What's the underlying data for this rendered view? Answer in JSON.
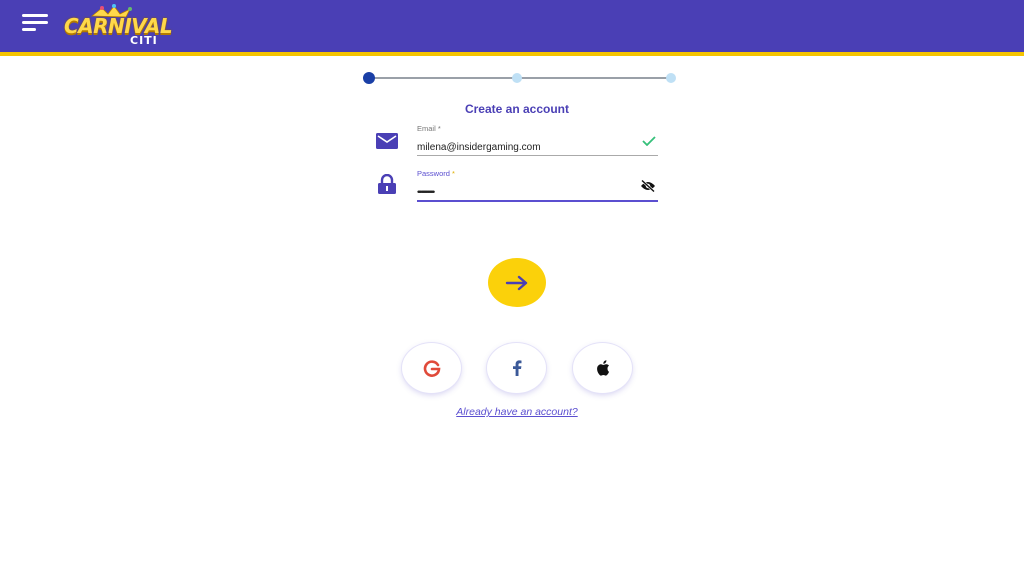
{
  "header": {
    "menu_icon": "hamburger-menu-icon",
    "logo": {
      "main": "CARNIVAL",
      "sub": "CITI"
    },
    "colors": {
      "bar": "#4a3fb5",
      "stripe": "#f5c400"
    }
  },
  "stepper": {
    "steps": 3,
    "current_step": 1
  },
  "form": {
    "title": "Create an account",
    "email": {
      "icon": "envelope-icon",
      "label": "Email",
      "required_mark": "*",
      "value": "milena@insidergaming.com",
      "status_icon": "checkmark-icon"
    },
    "password": {
      "icon": "lock-icon",
      "label": "Password",
      "required_mark": "*",
      "value": "••••••••••••••",
      "toggle_icon": "eye-slash-icon"
    },
    "next_button": {
      "icon": "arrow-right-icon",
      "color": "#fbd10a"
    }
  },
  "social": [
    {
      "name": "Google",
      "icon": "google-icon",
      "glyph": "G",
      "color": "#e04a3a"
    },
    {
      "name": "Facebook",
      "icon": "facebook-icon",
      "glyph": "f",
      "color": "#3b5998"
    },
    {
      "name": "Apple",
      "icon": "apple-icon",
      "glyph": "",
      "color": "#111111"
    }
  ],
  "signin_link": "Already have an account?"
}
